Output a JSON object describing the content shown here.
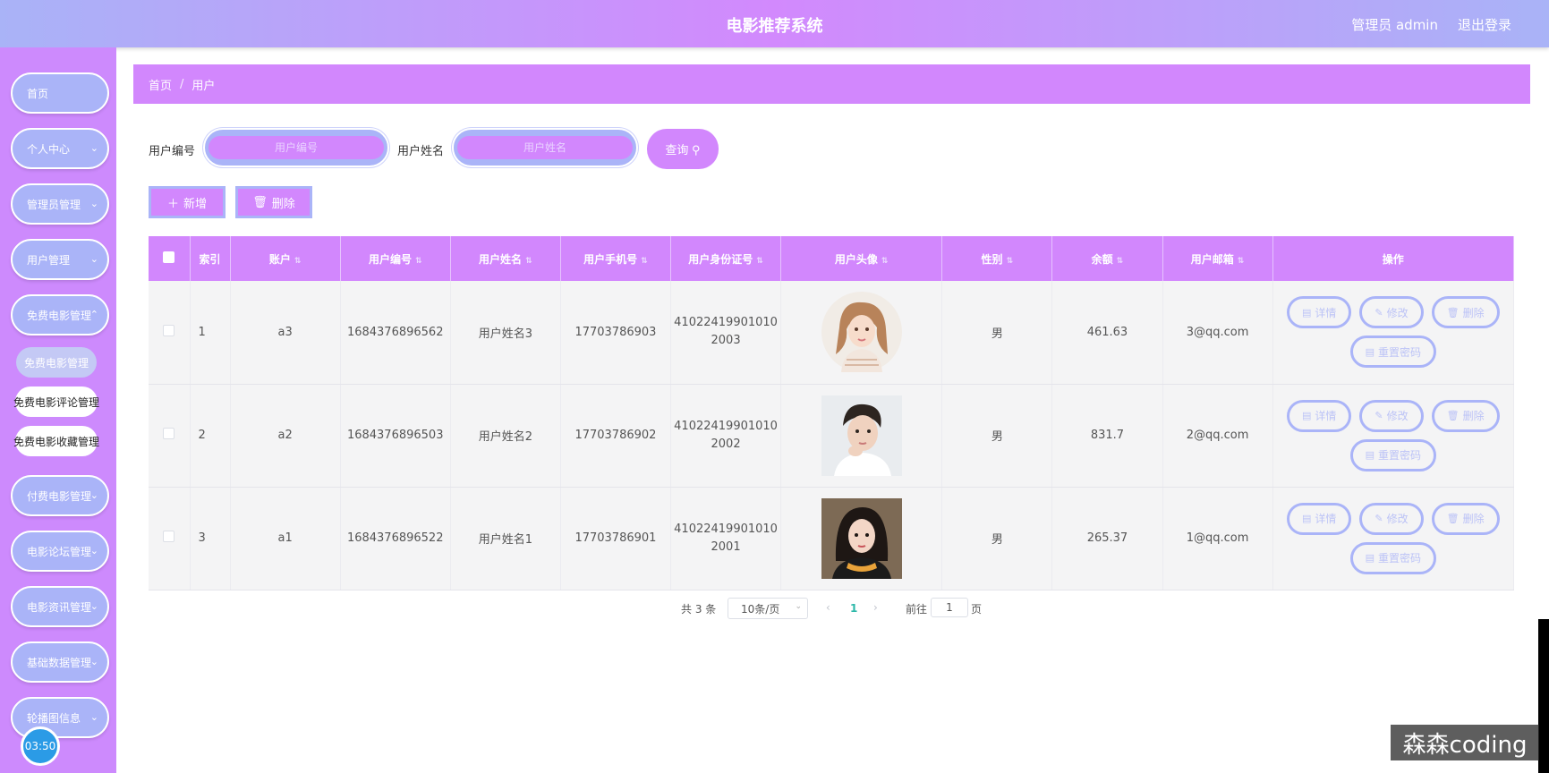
{
  "header": {
    "title": "电影推荐系统",
    "user": "管理员 admin",
    "logout": "退出登录"
  },
  "sidebar": {
    "items": [
      {
        "label": "首页"
      },
      {
        "label": "个人中心"
      },
      {
        "label": "管理员管理"
      },
      {
        "label": "用户管理"
      },
      {
        "label": "免费电影管理"
      },
      {
        "label": "付费电影管理"
      },
      {
        "label": "电影论坛管理"
      },
      {
        "label": "电影资讯管理"
      },
      {
        "label": "基础数据管理"
      },
      {
        "label": "轮播图信息"
      }
    ],
    "submenu": [
      {
        "label": "免费电影管理"
      },
      {
        "label": "免费电影评论管理"
      },
      {
        "label": "免费电影收藏管理"
      }
    ],
    "timer": "03:50"
  },
  "breadcrumb": {
    "home": "首页",
    "sep": "/",
    "current": "用户"
  },
  "search": {
    "label_no": "用户编号",
    "placeholder_no": "用户编号",
    "label_name": "用户姓名",
    "placeholder_name": "用户姓名",
    "query": "查询"
  },
  "actions": {
    "add": "新增",
    "delete": "删除"
  },
  "table": {
    "headers": {
      "index": "索引",
      "account": "账户",
      "user_no": "用户编号",
      "user_name": "用户姓名",
      "phone": "用户手机号",
      "id_card": "用户身份证号",
      "avatar": "用户头像",
      "gender": "性别",
      "balance": "余额",
      "email": "用户邮箱",
      "ops": "操作"
    },
    "rows": [
      {
        "index": "1",
        "account": "a3",
        "user_no": "1684376896562",
        "user_name": "用户姓名3",
        "phone": "17703786903",
        "id_line1": "41022419901010",
        "id_line2": "2003",
        "gender": "男",
        "balance": "461.63",
        "email": "3@qq.com"
      },
      {
        "index": "2",
        "account": "a2",
        "user_no": "1684376896503",
        "user_name": "用户姓名2",
        "phone": "17703786902",
        "id_line1": "41022419901010",
        "id_line2": "2002",
        "gender": "男",
        "balance": "831.7",
        "email": "2@qq.com"
      },
      {
        "index": "3",
        "account": "a1",
        "user_no": "1684376896522",
        "user_name": "用户姓名1",
        "phone": "17703786901",
        "id_line1": "41022419901010",
        "id_line2": "2001",
        "gender": "男",
        "balance": "265.37",
        "email": "1@qq.com"
      }
    ],
    "op_labels": {
      "detail": "详情",
      "edit": "修改",
      "delete": "删除",
      "reset": "重置密码"
    }
  },
  "pagination": {
    "total": "共 3 条",
    "page_size": "10条/页",
    "current": "1",
    "goto": "前往",
    "goto_value": "1",
    "unit": "页"
  },
  "watermark": "森森coding",
  "colors": {
    "accent": "#d287fd",
    "pill": "#aab4f8",
    "sidebar": "#cd8afd"
  }
}
